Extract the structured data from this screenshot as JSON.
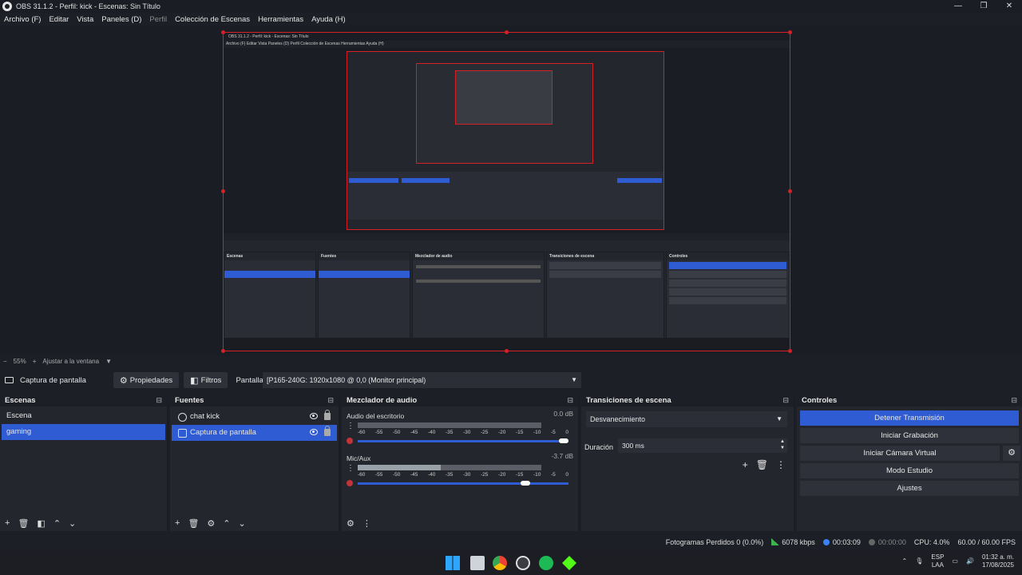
{
  "window": {
    "title": "OBS 31.1.2 - Perfil: kick - Escenas: Sin Título",
    "controls": [
      "—",
      "❐",
      "✕"
    ]
  },
  "menu": [
    "Archivo (F)",
    "Editar",
    "Vista",
    "Paneles (D)",
    "Perfil",
    "Colección de Escenas",
    "Herramientas",
    "Ayuda (H)"
  ],
  "zoom": {
    "minus": "−",
    "level": "55%",
    "plus": "+",
    "fit_label": "Ajustar a la ventana",
    "caret": "▼"
  },
  "source_toolbar": {
    "source_name": "Captura de pantalla",
    "properties_label": "Propiedades",
    "filters_label": "Filtros",
    "screen_label": "Pantalla",
    "screen_value": "[P165-240G: 1920x1080 @ 0,0 (Monitor principal)",
    "caret": "▼"
  },
  "scenes": {
    "header": "Escenas",
    "items": [
      "Escena",
      "gaming"
    ],
    "selected_index": 1
  },
  "sources": {
    "header": "Fuentes",
    "items": [
      "chat kick",
      "Captura de pantalla"
    ],
    "selected_index": 1
  },
  "mixer": {
    "header": "Mezclador de audio",
    "scale": [
      "-60",
      "-55",
      "-50",
      "-45",
      "-40",
      "-35",
      "-30",
      "-25",
      "-20",
      "-15",
      "-10",
      "-5",
      "0"
    ],
    "tracks": [
      {
        "name": "Audio del escritorio",
        "db": "0.0 dB",
        "level": 0.0,
        "volume": 1.0
      },
      {
        "name": "Mic/Aux",
        "db": "-3.7 dB",
        "level": 0.45,
        "volume": 0.82
      }
    ]
  },
  "transitions": {
    "header": "Transiciones de escena",
    "selected": "Desvanecimiento",
    "duration_label": "Duración",
    "duration_value": "300 ms"
  },
  "controls": {
    "header": "Controles",
    "buttons": [
      "Detener Transmisión",
      "Iniciar Grabación",
      "Iniciar Cámara Virtual",
      "Modo Estudio",
      "Ajustes"
    ]
  },
  "status": {
    "dropped": "Fotogramas Perdidos 0 (0.0%)",
    "bitrate": "6078 kbps",
    "stream_time": "00:03:09",
    "rec_time": "00:00:00",
    "cpu": "CPU: 4.0%",
    "fps": "60.00 / 60.00 FPS"
  },
  "tray": {
    "lang": "ESP",
    "region": "LAA",
    "time": "01:32 a. m.",
    "date": "17/08/2025"
  },
  "nested_preview": {
    "title": "OBS 31.1.2 - Perfil: kick - Escenas: Sin Título",
    "menu": "Archivo (F)  Editar  Vista  Paneles (D)  Perfil  Colección de Escenas  Herramientas  Ayuda (H)",
    "scenes_header": "Escenas",
    "sources_header": "Fuentes",
    "mixer_header": "Mezclador de audio",
    "transitions_header": "Transiciones de escena",
    "controls_header": "Controles"
  },
  "colors": {
    "accent": "#2f5bd3",
    "selection_border": "#d71f26",
    "background": "#1d1f26",
    "panel": "#24262d"
  }
}
